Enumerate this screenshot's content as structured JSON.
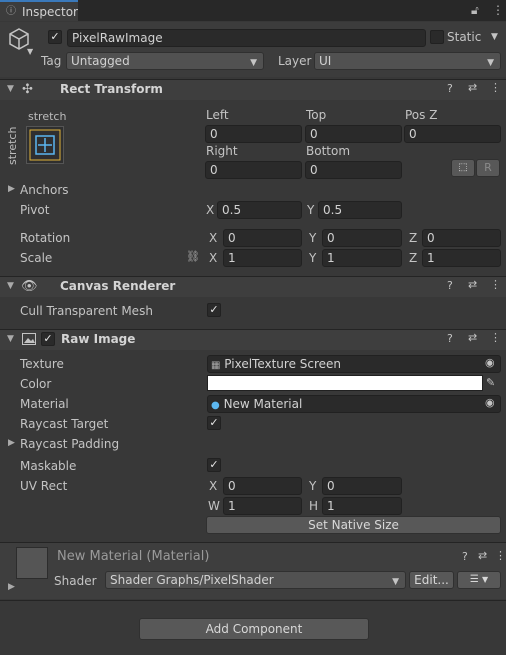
{
  "tab": {
    "title": "Inspector"
  },
  "object": {
    "name": "PixelRawImage",
    "static_label": "Static",
    "tag_label": "Tag",
    "tag_value": "Untagged",
    "layer_label": "Layer",
    "layer_value": "UI"
  },
  "rect_transform": {
    "title": "Rect Transform",
    "anchor_top": "stretch",
    "anchor_side": "stretch",
    "left_label": "Left",
    "left": "0",
    "top_label": "Top",
    "top": "0",
    "posz_label": "Pos Z",
    "posz": "0",
    "right_label": "Right",
    "right": "0",
    "bottom_label": "Bottom",
    "bottom": "0",
    "r_button": "R",
    "anchors_label": "Anchors",
    "pivot_label": "Pivot",
    "pivot_x": "0.5",
    "pivot_y": "0.5",
    "rotation_label": "Rotation",
    "rot_x": "0",
    "rot_y": "0",
    "rot_z": "0",
    "scale_label": "Scale",
    "scale_x": "1",
    "scale_y": "1",
    "scale_z": "1",
    "x": "X",
    "y": "Y",
    "z": "Z"
  },
  "canvas_renderer": {
    "title": "Canvas Renderer",
    "cull_label": "Cull Transparent Mesh",
    "cull": true
  },
  "raw_image": {
    "title": "Raw Image",
    "texture_label": "Texture",
    "texture_value": "PixelTexture Screen",
    "color_label": "Color",
    "color_value": "#ffffff",
    "material_label": "Material",
    "material_value": "New Material",
    "raycast_target_label": "Raycast Target",
    "raycast_padding_label": "Raycast Padding",
    "maskable_label": "Maskable",
    "uvrect_label": "UV Rect",
    "uv_x": "0",
    "uv_y": "0",
    "uv_w": "1",
    "uv_h": "1",
    "x": "X",
    "y": "Y",
    "w": "W",
    "h": "H",
    "native_size_button": "Set Native Size"
  },
  "material": {
    "title": "New Material (Material)",
    "shader_label": "Shader",
    "shader_value": "Shader Graphs/PixelShader",
    "edit_button": "Edit..."
  },
  "add_component_button": "Add Component",
  "colors": {
    "accent": "#3a79bb",
    "panel": "#383838",
    "header": "#3e3e3e",
    "field": "#2a2a2a"
  }
}
